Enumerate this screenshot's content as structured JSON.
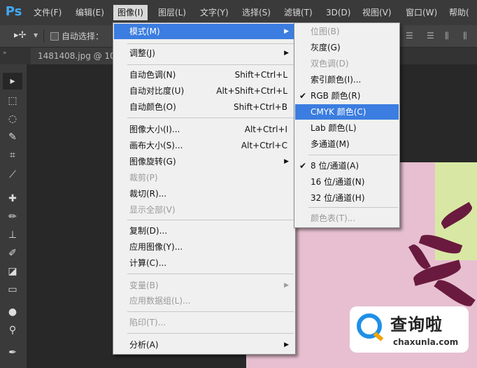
{
  "app": {
    "logo": "Ps",
    "document_tab": "1481408.jpg @ 10"
  },
  "menubar": [
    {
      "label": "文件(F)"
    },
    {
      "label": "编辑(E)"
    },
    {
      "label": "图像(I)"
    },
    {
      "label": "图层(L)"
    },
    {
      "label": "文字(Y)"
    },
    {
      "label": "选择(S)"
    },
    {
      "label": "滤镜(T)"
    },
    {
      "label": "3D(D)"
    },
    {
      "label": "视图(V)"
    },
    {
      "label": "窗口(W)"
    },
    {
      "label": "帮助("
    }
  ],
  "options": {
    "auto_select": "自动选择："
  },
  "image_menu": [
    {
      "label": "模式(M)",
      "shortcut": "",
      "arrow": true
    },
    {
      "label": "调整(J)",
      "shortcut": "",
      "arrow": true
    },
    {
      "label": "自动色调(N)",
      "shortcut": "Shift+Ctrl+L"
    },
    {
      "label": "自动对比度(U)",
      "shortcut": "Alt+Shift+Ctrl+L"
    },
    {
      "label": "自动颜色(O)",
      "shortcut": "Shift+Ctrl+B"
    },
    {
      "label": "图像大小(I)...",
      "shortcut": "Alt+Ctrl+I"
    },
    {
      "label": "画布大小(S)...",
      "shortcut": "Alt+Ctrl+C"
    },
    {
      "label": "图像旋转(G)",
      "shortcut": "",
      "arrow": true
    },
    {
      "label": "裁剪(P)",
      "shortcut": "",
      "disabled": true
    },
    {
      "label": "裁切(R)...",
      "shortcut": ""
    },
    {
      "label": "显示全部(V)",
      "shortcut": "",
      "disabled": true
    },
    {
      "label": "复制(D)...",
      "shortcut": ""
    },
    {
      "label": "应用图像(Y)...",
      "shortcut": ""
    },
    {
      "label": "计算(C)...",
      "shortcut": ""
    },
    {
      "label": "变量(B)",
      "shortcut": "",
      "arrow": true,
      "disabled": true
    },
    {
      "label": "应用数据组(L)...",
      "shortcut": "",
      "disabled": true
    },
    {
      "label": "陷印(T)...",
      "shortcut": "",
      "disabled": true
    },
    {
      "label": "分析(A)",
      "shortcut": "",
      "arrow": true
    }
  ],
  "mode_submenu": [
    {
      "label": "位图(B)",
      "disabled": true
    },
    {
      "label": "灰度(G)"
    },
    {
      "label": "双色调(D)",
      "disabled": true
    },
    {
      "label": "索引颜色(I)..."
    },
    {
      "label": "RGB 颜色(R)",
      "checked": true
    },
    {
      "label": "CMYK 颜色(C)",
      "highlighted": true
    },
    {
      "label": "Lab 颜色(L)"
    },
    {
      "label": "多通道(M)"
    },
    {
      "label": "8 位/通道(A)",
      "checked": true
    },
    {
      "label": "16 位/通道(N)"
    },
    {
      "label": "32 位/通道(H)"
    },
    {
      "label": "颜色表(T)...",
      "disabled": true
    }
  ],
  "check_glyph": "✔",
  "arrow_glyph": "▶",
  "watermark": {
    "title": "查询啦",
    "url": "chaxunla.com"
  },
  "colors": {
    "highlight": "#3b7de0",
    "menubar": "#3a3a3a",
    "logo": "#41a9f5"
  }
}
